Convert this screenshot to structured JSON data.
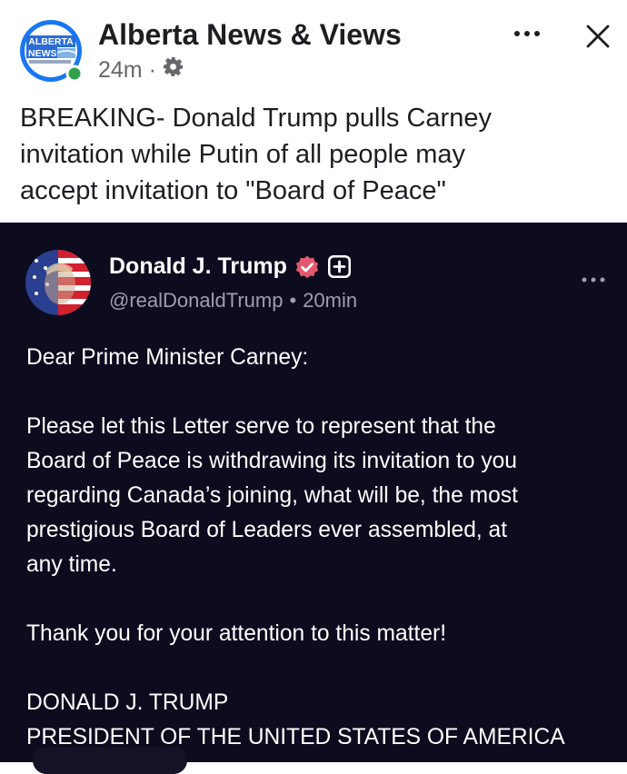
{
  "post": {
    "page_name": "Alberta News & Views",
    "time_ago": "24m",
    "separator": "·",
    "avatar_logo_text": "ALBERTA NEWS",
    "icons": {
      "more": "more-horizontal-icon",
      "close": "close-icon",
      "audience": "gear-icon",
      "online": "online-dot-icon"
    },
    "text_lines": [
      "BREAKING- Donald Trump pulls Carney",
      "invitation while Putin of all people may",
      "accept invitation to \"Board of Peace\""
    ]
  },
  "truth_social": {
    "author_name": "Donald J. Trump",
    "handle": "@realDonaldTrump",
    "dot": "•",
    "time_ago": "20min",
    "icons": {
      "verified": "verified-badge-icon",
      "follow": "plus-icon",
      "more": "more-horizontal-icon"
    },
    "body": {
      "greeting": "Dear Prime Minister Carney:",
      "paragraph_lines": [
        "Please let this Letter serve to represent that the",
        "Board of Peace is withdrawing its invitation to you",
        "regarding Canada’s joining, what will be, the most",
        "prestigious Board of Leaders ever assembled, at",
        "any time."
      ],
      "thanks": "Thank you for your attention to this matter!",
      "signature_name": "DONALD J. TRUMP",
      "signature_title": "PRESIDENT OF THE UNITED STATES OF AMERICA"
    }
  },
  "colors": {
    "embed_background": "#0d0b1e",
    "verified_badge": "#e2586d",
    "online_dot": "#31a24c",
    "avatar_ring": "#1877f2"
  }
}
